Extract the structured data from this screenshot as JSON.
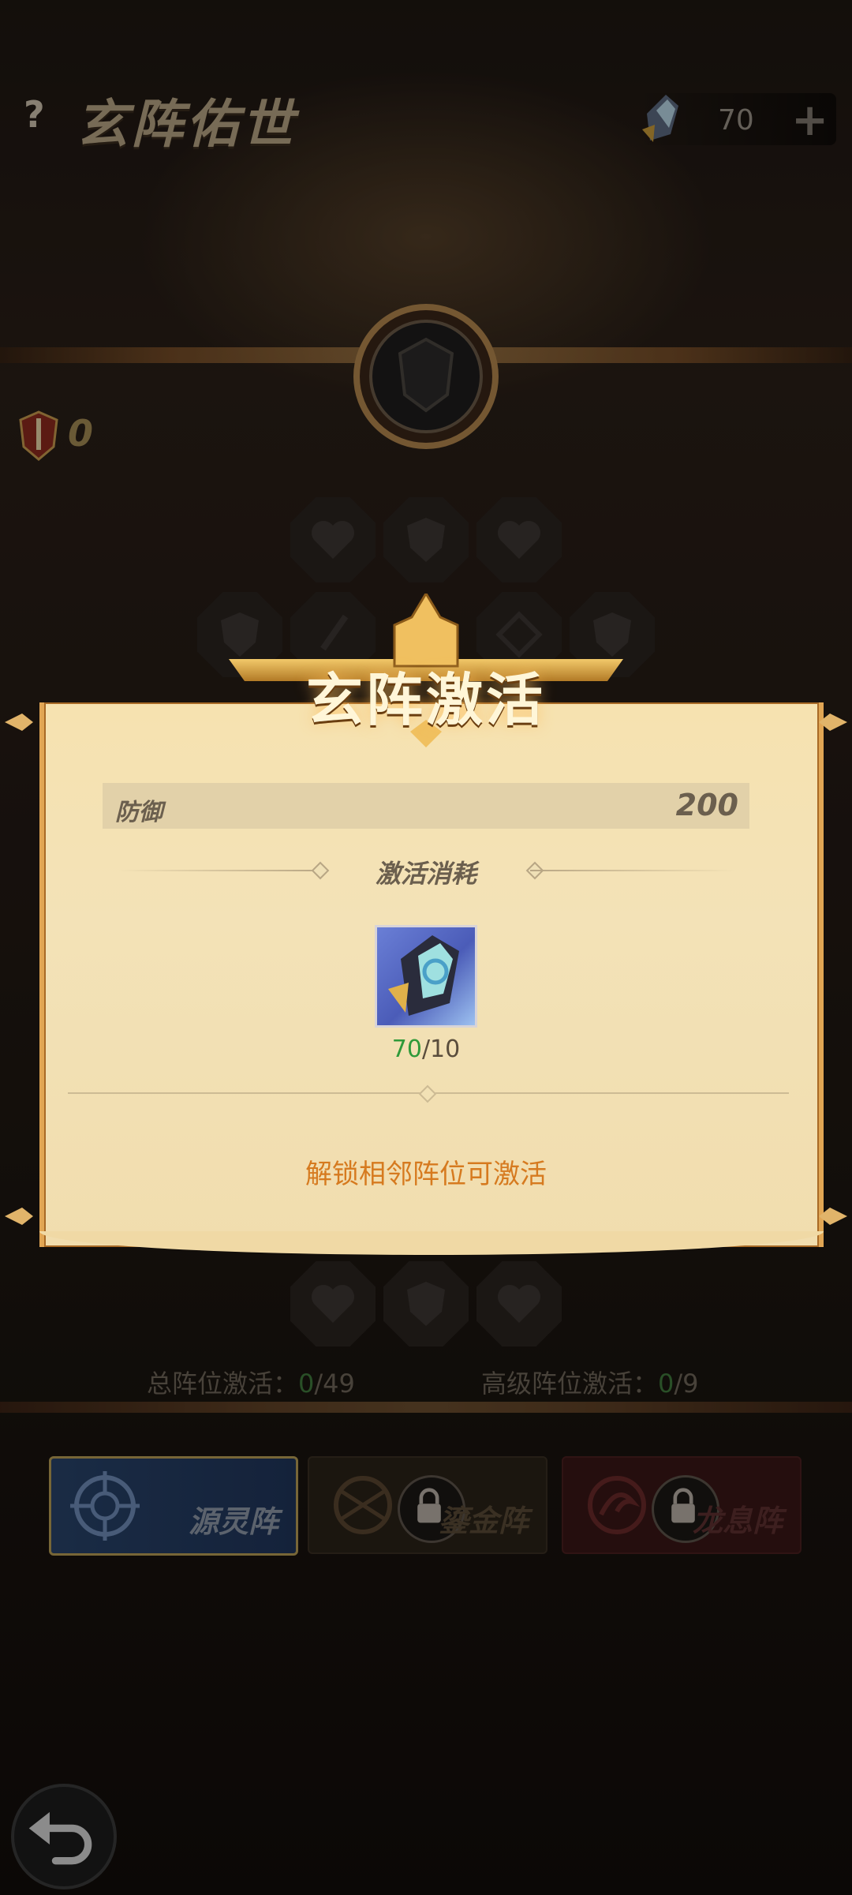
{
  "header": {
    "help_label": "?",
    "title": "玄阵佑世",
    "currency_icon": "crystal-shard-icon",
    "currency_value": "70",
    "add_label": "+"
  },
  "left_badge": {
    "icon": "shield-sword-icon",
    "count": "0"
  },
  "stats": {
    "total_label": "总阵位激活：",
    "total_value": "0",
    "total_max": "/49",
    "advanced_label": "高级阵位激活：",
    "advanced_value": "0",
    "advanced_max": "/9"
  },
  "tabs": [
    {
      "label": "源灵阵",
      "selected": true,
      "locked": false
    },
    {
      "label": "鎏金阵",
      "selected": false,
      "locked": true
    },
    {
      "label": "龙息阵",
      "selected": false,
      "locked": true
    }
  ],
  "modal": {
    "title": "玄阵激活",
    "attribute": {
      "label": "防御",
      "value": "200"
    },
    "cost_title": "激活消耗",
    "item": {
      "icon": "crystal-shard-icon",
      "owned": "70",
      "required": "/10"
    },
    "hint": "解锁相邻阵位可激活"
  },
  "colors": {
    "accent_gold": "#e1a654",
    "hint_orange": "#d67a1f",
    "green_count": "#2f9a3a",
    "scroll_bg": "#f3e2b7"
  }
}
